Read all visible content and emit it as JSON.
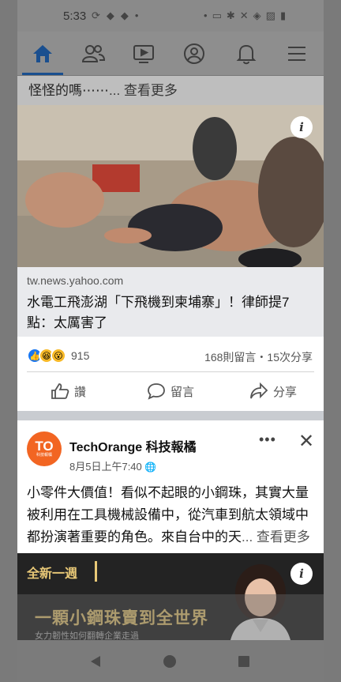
{
  "status_bar": {
    "time": "5:33",
    "left_icons": [
      "sync-icon",
      "android-icon",
      "android-icon",
      "dot-icon"
    ],
    "right_icons": [
      "dot-icon",
      "cast-icon",
      "bluetooth-icon",
      "mute-icon",
      "wifi-icon",
      "no-sim-icon",
      "battery-icon"
    ]
  },
  "nav": {
    "items": [
      {
        "name": "home",
        "icon": "home-icon",
        "active": true
      },
      {
        "name": "friends",
        "icon": "friends-icon",
        "active": false
      },
      {
        "name": "watch",
        "icon": "video-icon",
        "active": false
      },
      {
        "name": "profile",
        "icon": "profile-icon",
        "active": false
      },
      {
        "name": "notifications",
        "icon": "bell-icon",
        "active": false
      },
      {
        "name": "menu",
        "icon": "menu-icon",
        "active": false
      }
    ]
  },
  "post1": {
    "caption_tail": "怪怪的嗎⋯⋯",
    "see_more": "... 查看更多",
    "link_domain": "tw.news.yahoo.com",
    "link_title": "水電工飛澎湖「下飛機到柬埔寨」！律師提7點：太厲害了",
    "reaction_count": "915",
    "reaction_meta": "168則留言・15次分享",
    "actions": {
      "like": "讚",
      "comment": "留言",
      "share": "分享"
    }
  },
  "post2": {
    "avatar_text": "TO",
    "avatar_sub": "科技報橘",
    "page_name": "TechOrange 科技報橘",
    "time": "8月5日上午7:40",
    "text": "小零件大價值！看似不起眼的小鋼珠，其實大量被利用在工具機械設備中，從汽車到航太領域中都扮演著重要的角色。來自台中的天",
    "see_more": "... 查看更多",
    "more_label": "•••",
    "close_label": "✕"
  },
  "banner": {
    "tag": "全新一週",
    "title": "一顆小鋼珠賣到全世界",
    "subtitle": "女力韌性如何翻轉企業走過"
  },
  "info_label": "i",
  "colors": {
    "accent": "#1877f2",
    "banner_gold": "#e8c877",
    "avatar_orange": "#f26522"
  }
}
